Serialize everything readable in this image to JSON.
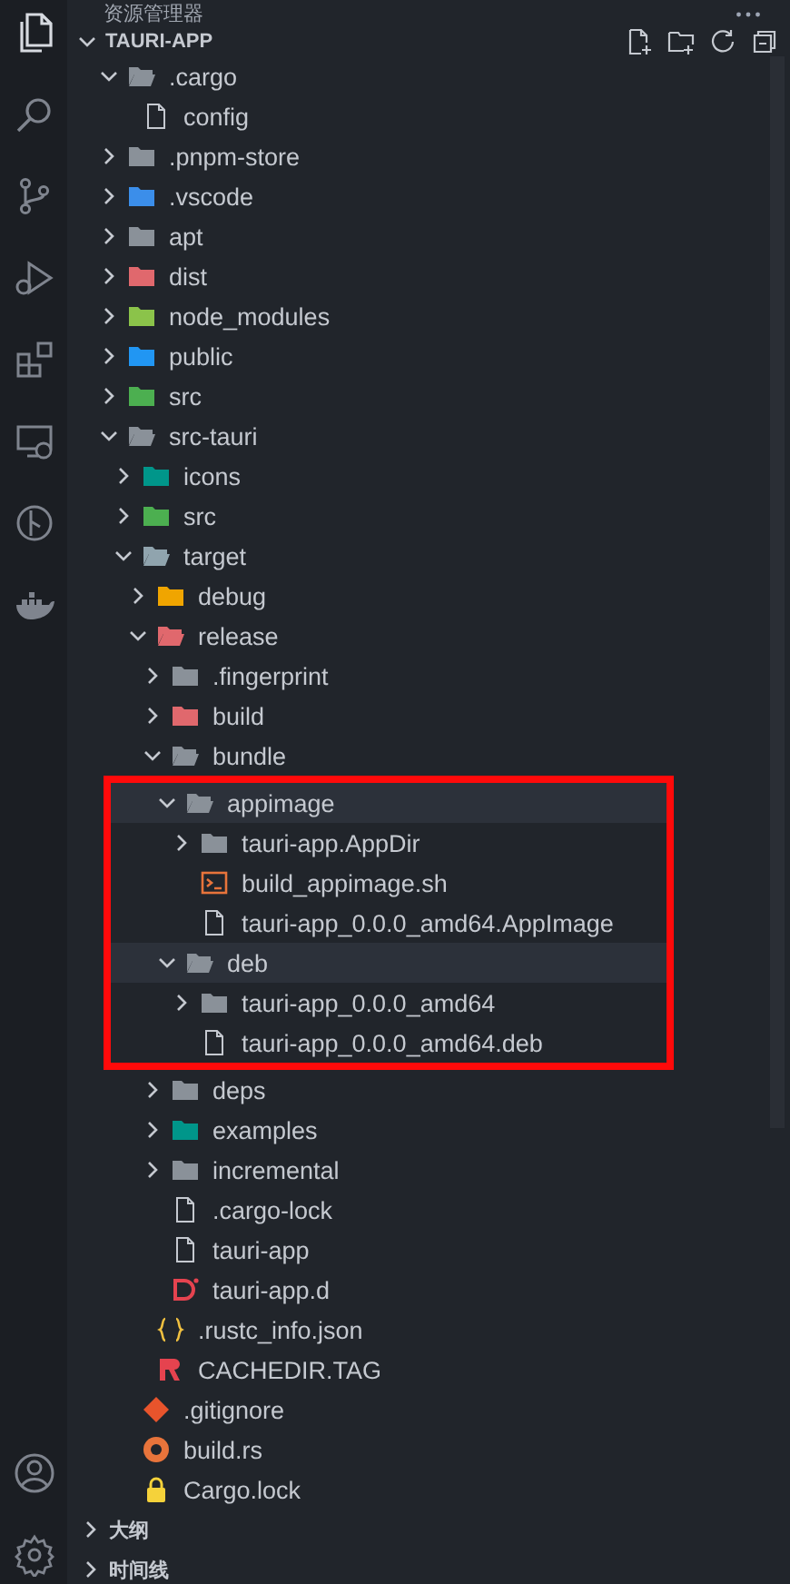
{
  "panel": {
    "title": "资源管理器"
  },
  "explorer": {
    "root": {
      "label": "TAURI-APP",
      "expanded": true
    },
    "tree": [
      {
        "label": ".cargo",
        "kind": "folder",
        "color": "#8a9199",
        "expanded": true,
        "selected": false,
        "children": [
          {
            "label": "config",
            "kind": "file",
            "selected": false
          }
        ]
      },
      {
        "label": ".pnpm-store",
        "kind": "folder",
        "color": "#8a9199",
        "expanded": false,
        "selected": false
      },
      {
        "label": ".vscode",
        "kind": "folder",
        "color": "#3b8eea",
        "expanded": false,
        "selected": false
      },
      {
        "label": "apt",
        "kind": "folder",
        "color": "#8a9199",
        "expanded": false,
        "selected": false
      },
      {
        "label": "dist",
        "kind": "folder",
        "color": "#e0686d",
        "expanded": false,
        "selected": false
      },
      {
        "label": "node_modules",
        "kind": "folder",
        "color": "#8bc34a",
        "expanded": false,
        "selected": false
      },
      {
        "label": "public",
        "kind": "folder",
        "color": "#2196f3",
        "expanded": false,
        "selected": false
      },
      {
        "label": "src",
        "kind": "folder",
        "color": "#4caf50",
        "expanded": false,
        "selected": false
      },
      {
        "label": "src-tauri",
        "kind": "folder",
        "color": "#8a9199",
        "expanded": true,
        "selected": false,
        "children": [
          {
            "label": "icons",
            "kind": "folder",
            "color": "#00968a",
            "expanded": false,
            "selected": false
          },
          {
            "label": "src",
            "kind": "folder",
            "color": "#4caf50",
            "expanded": false,
            "selected": false
          },
          {
            "label": "target",
            "kind": "folder",
            "color": "#90a4ae",
            "expanded": true,
            "selected": false,
            "children": [
              {
                "label": "debug",
                "kind": "folder",
                "color": "#f0a500",
                "expanded": false,
                "selected": false
              },
              {
                "label": "release",
                "kind": "folder",
                "color": "#e0686d",
                "expanded": true,
                "selected": false,
                "children": [
                  {
                    "label": ".fingerprint",
                    "kind": "folder",
                    "color": "#8a9199",
                    "expanded": false,
                    "selected": false
                  },
                  {
                    "label": "build",
                    "kind": "folder",
                    "color": "#e0686d",
                    "expanded": false,
                    "selected": false
                  },
                  {
                    "label": "bundle",
                    "kind": "folder",
                    "color": "#8a9199",
                    "expanded": true,
                    "selected": false,
                    "highlighted": true,
                    "children": [
                      {
                        "label": "appimage",
                        "kind": "folder",
                        "color": "#8a9199",
                        "expanded": true,
                        "selected": true,
                        "children": [
                          {
                            "label": "tauri-app.AppDir",
                            "kind": "folder",
                            "color": "#8a9199",
                            "expanded": false,
                            "selected": false
                          },
                          {
                            "label": "build_appimage.sh",
                            "kind": "shell",
                            "selected": false
                          },
                          {
                            "label": "tauri-app_0.0.0_amd64.AppImage",
                            "kind": "file",
                            "selected": false
                          }
                        ]
                      },
                      {
                        "label": "deb",
                        "kind": "folder",
                        "color": "#8a9199",
                        "expanded": true,
                        "selected": true,
                        "children": [
                          {
                            "label": "tauri-app_0.0.0_amd64",
                            "kind": "folder",
                            "color": "#8a9199",
                            "expanded": false,
                            "selected": false
                          },
                          {
                            "label": "tauri-app_0.0.0_amd64.deb",
                            "kind": "file",
                            "selected": false
                          }
                        ]
                      }
                    ]
                  },
                  {
                    "label": "deps",
                    "kind": "folder",
                    "color": "#8a9199",
                    "expanded": false,
                    "selected": false
                  },
                  {
                    "label": "examples",
                    "kind": "folder",
                    "color": "#00968a",
                    "expanded": false,
                    "selected": false
                  },
                  {
                    "label": "incremental",
                    "kind": "folder",
                    "color": "#8a9199",
                    "expanded": false,
                    "selected": false
                  },
                  {
                    "label": ".cargo-lock",
                    "kind": "file",
                    "selected": false
                  },
                  {
                    "label": "tauri-app",
                    "kind": "file",
                    "selected": false
                  },
                  {
                    "label": "tauri-app.d",
                    "kind": "dfile",
                    "selected": false
                  }
                ]
              },
              {
                "label": ".rustc_info.json",
                "kind": "json",
                "selected": false
              },
              {
                "label": "CACHEDIR.TAG",
                "kind": "tag",
                "selected": false
              }
            ]
          },
          {
            "label": ".gitignore",
            "kind": "git",
            "selected": false
          },
          {
            "label": "build.rs",
            "kind": "rust",
            "selected": false
          },
          {
            "label": "Cargo.lock",
            "kind": "lock",
            "selected": false
          }
        ]
      }
    ]
  },
  "sections": [
    {
      "label": "大纲",
      "expanded": false
    },
    {
      "label": "时间线",
      "expanded": false
    }
  ]
}
